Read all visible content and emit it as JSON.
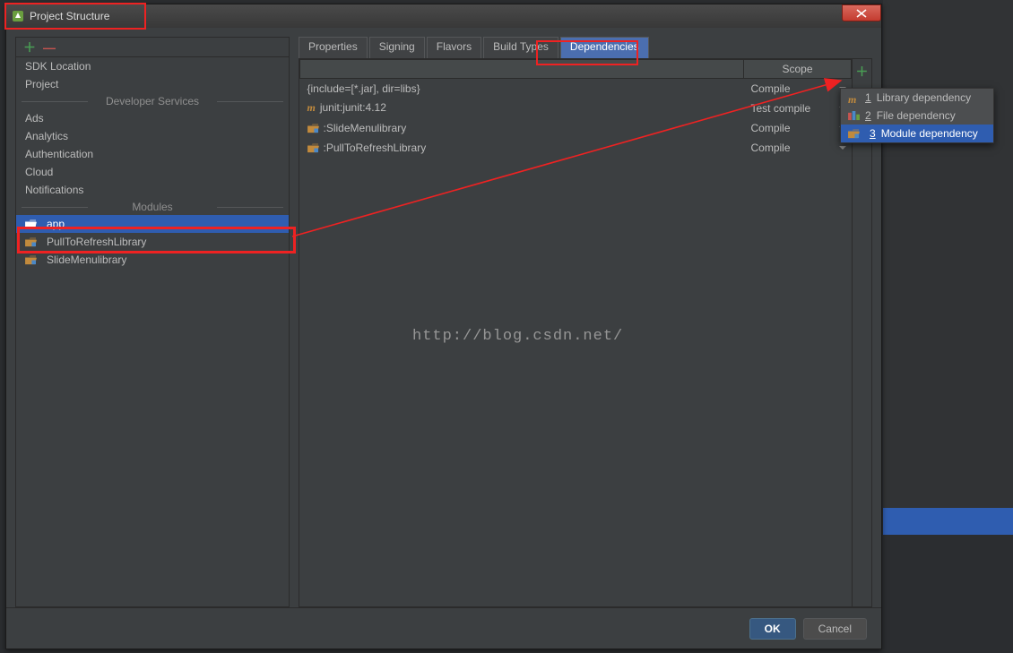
{
  "window": {
    "title": "Project Structure"
  },
  "left": {
    "items": [
      {
        "label": "SDK Location",
        "type": "item"
      },
      {
        "label": "Project",
        "type": "item"
      },
      {
        "label": "Developer Services",
        "type": "section"
      },
      {
        "label": "Ads",
        "type": "item"
      },
      {
        "label": "Analytics",
        "type": "item"
      },
      {
        "label": "Authentication",
        "type": "item"
      },
      {
        "label": "Cloud",
        "type": "item"
      },
      {
        "label": "Notifications",
        "type": "item"
      },
      {
        "label": "Modules",
        "type": "section"
      },
      {
        "label": "app",
        "type": "module",
        "selected": true
      },
      {
        "label": "PullToRefreshLibrary",
        "type": "module"
      },
      {
        "label": "SlideMenulibrary",
        "type": "module"
      }
    ]
  },
  "tabs": [
    {
      "label": "Properties"
    },
    {
      "label": "Signing"
    },
    {
      "label": "Flavors"
    },
    {
      "label": "Build Types"
    },
    {
      "label": "Dependencies",
      "active": true
    }
  ],
  "table": {
    "scope_header": "Scope",
    "rows": [
      {
        "icon": "none",
        "name": "{include=[*.jar], dir=libs}",
        "scope": "Compile"
      },
      {
        "icon": "m",
        "name": "junit:junit:4.12",
        "scope": "Test compile"
      },
      {
        "icon": "module",
        "name": ":SlideMenulibrary",
        "scope": "Compile"
      },
      {
        "icon": "module",
        "name": ":PullToRefreshLibrary",
        "scope": "Compile"
      }
    ]
  },
  "popup": {
    "items": [
      {
        "num": "1",
        "label": "Library dependency",
        "icon": "m"
      },
      {
        "num": "2",
        "label": "File dependency",
        "icon": "file"
      },
      {
        "num": "3",
        "label": "Module dependency",
        "icon": "module",
        "selected": true
      }
    ]
  },
  "footer": {
    "ok": "OK",
    "cancel": "Cancel"
  },
  "watermark": "http://blog.csdn.net/"
}
